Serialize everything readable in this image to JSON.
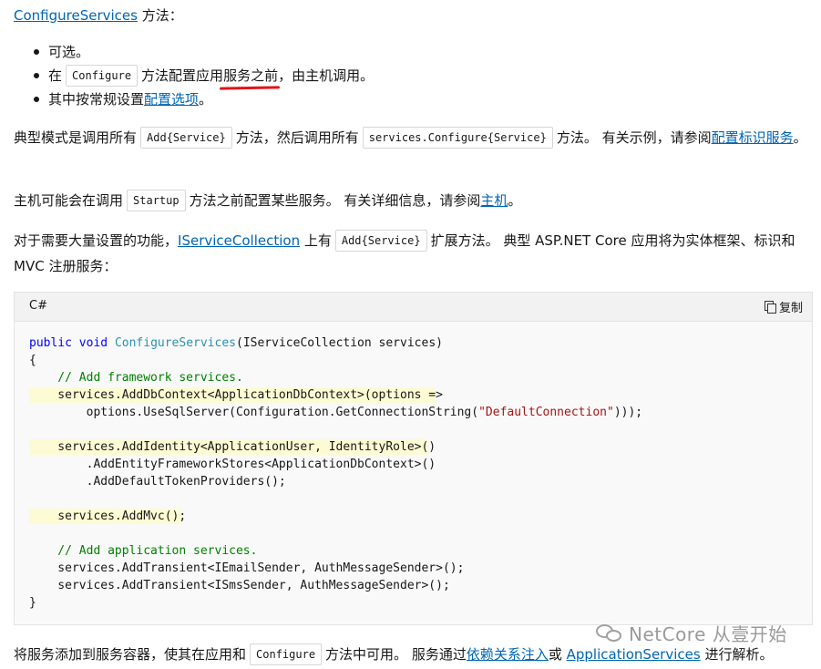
{
  "heading": {
    "link": "ConfigureServices",
    "suffix": " 方法："
  },
  "bullets": [
    {
      "text": "可选。"
    },
    {
      "pre": "在",
      "code": "Configure",
      "mid": "方法配置应用",
      "underlined": "服务之前",
      "post": "，由主机调用。"
    },
    {
      "pre": "其中按常规设置",
      "link": "配置选项",
      "post": "。"
    }
  ],
  "para1": {
    "t1": "典型模式是调用所有",
    "c1": "Add{Service}",
    "t2": "方法，然后调用所有",
    "c2": "services.Configure{Service}",
    "t3": "方法。 有关示例，请参阅",
    "link": "配置标识服务",
    "t4": "。"
  },
  "para2": {
    "t1": "主机可能会在调用",
    "code": "Startup",
    "t2": "方法之前配置某些服务。 有关详细信息，请参阅",
    "link": "主机",
    "t3": "。"
  },
  "para3": {
    "t1": "对于需要大量设置的功能，",
    "link": "IServiceCollection",
    "t2": " 上有",
    "code": "Add{Service}",
    "t3": "扩展方法。 典型 ASP.NET Core 应用将为实体框架、标识和 MVC 注册服务："
  },
  "codeblock": {
    "language": "C#",
    "copy_label": "复制",
    "lines": {
      "l1a": "public",
      "l1b": "void",
      "l1c": "ConfigureServices",
      "l1d": "(IServiceCollection services)",
      "l2": "{",
      "l3": "    // Add framework services.",
      "l4a": "    services.AddDbContext<ApplicationDbContext>(options =>",
      "l5a": "        options.UseSqlServer(Configuration.GetConnectionString(",
      "l5b": "\"DefaultConnection\"",
      "l5c": ")));",
      "l6": "",
      "l7": "    services.AddIdentity<ApplicationUser, IdentityRole>()",
      "l8": "        .AddEntityFrameworkStores<ApplicationDbContext>()",
      "l9": "        .AddDefaultTokenProviders();",
      "l10": "",
      "l11": "    services.AddMvc();",
      "l12": "",
      "l13": "    // Add application services.",
      "l14": "    services.AddTransient<IEmailSender, AuthMessageSender>();",
      "l15": "    services.AddTransient<ISmsSender, AuthMessageSender>();",
      "l16": "}"
    }
  },
  "para4": {
    "t1": "将服务添加到服务容器，使其在应用和",
    "code": "Configure",
    "t2": "方法中可用。 服务通过",
    "link1": "依赖关系注入",
    "t3": "或 ",
    "link2": "ApplicationServices",
    "t4": " 进行解析。"
  },
  "watermark": {
    "text": "NetCore 从壹开始"
  },
  "colors": {
    "link": "#0065b3",
    "highlight": "#fdfbd3",
    "underline": "#e3141a"
  }
}
